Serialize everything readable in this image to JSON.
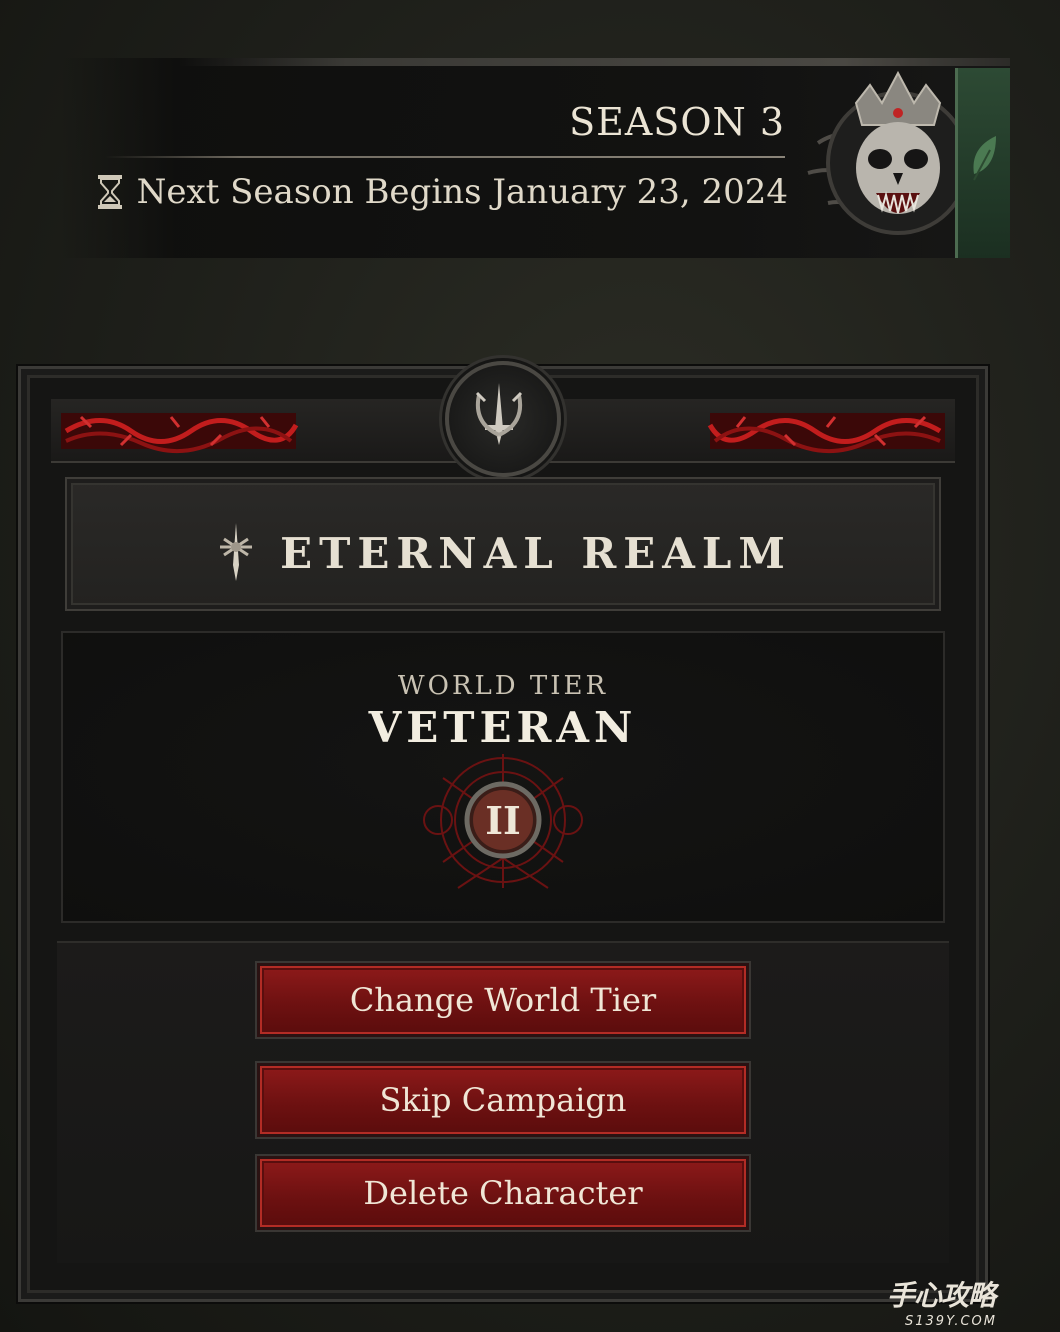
{
  "season": {
    "title": "SEASON 3",
    "next_season_text": "Next Season Begins January 23, 2024",
    "hourglass_icon": "hourglass-icon",
    "emblem_icon": "crowned-skull-emblem"
  },
  "realm": {
    "title": "ETERNAL REALM",
    "icon": "sword-icon"
  },
  "world_tier": {
    "label": "WORLD TIER",
    "value": "VETERAN",
    "numeral": "II"
  },
  "actions": {
    "change_tier": "Change World Tier",
    "skip_campaign": "Skip Campaign",
    "delete_character": "Delete Character"
  },
  "watermark": {
    "main": "手心攻略",
    "sub": "S139Y.COM"
  },
  "colors": {
    "button_red": "#8e1a1a",
    "text_light": "#ebe4d4",
    "panel_dark": "#151514"
  }
}
